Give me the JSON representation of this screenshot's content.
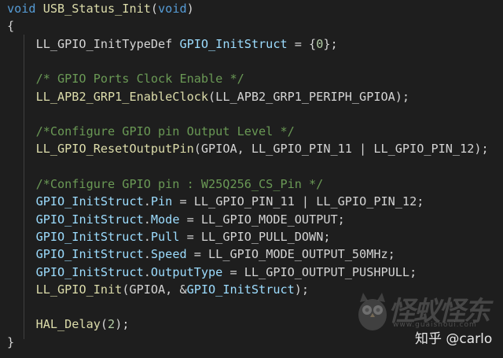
{
  "code_lines": [
    [
      {
        "t": "void ",
        "c": "kw"
      },
      {
        "t": "USB_Status_Init",
        "c": "fn"
      },
      {
        "t": "(",
        "c": "pl"
      },
      {
        "t": "void",
        "c": "kw"
      },
      {
        "t": ")",
        "c": "pl"
      }
    ],
    [
      {
        "t": "{",
        "c": "pl"
      }
    ],
    [
      {
        "t": "    LL_GPIO_InitTypeDef ",
        "c": "pl"
      },
      {
        "t": "GPIO_InitStruct",
        "c": "var"
      },
      {
        "t": " = {",
        "c": "pl"
      },
      {
        "t": "0",
        "c": "num"
      },
      {
        "t": "};",
        "c": "pl"
      }
    ],
    [],
    [
      {
        "t": "    /* GPIO Ports Clock Enable */",
        "c": "cm"
      }
    ],
    [
      {
        "t": "    ",
        "c": "pl"
      },
      {
        "t": "LL_APB2_GRP1_EnableClock",
        "c": "fn"
      },
      {
        "t": "(LL_APB2_GRP1_PERIPH_GPIOA);",
        "c": "pl"
      }
    ],
    [],
    [
      {
        "t": "    /*Configure GPIO pin Output Level */",
        "c": "cm"
      }
    ],
    [
      {
        "t": "    ",
        "c": "pl"
      },
      {
        "t": "LL_GPIO_ResetOutputPin",
        "c": "fn"
      },
      {
        "t": "(GPIOA, LL_GPIO_PIN_11 | LL_GPIO_PIN_12);",
        "c": "pl"
      }
    ],
    [],
    [
      {
        "t": "    /*Configure GPIO pin : W25Q256_CS_Pin */",
        "c": "cm"
      }
    ],
    [
      {
        "t": "    ",
        "c": "pl"
      },
      {
        "t": "GPIO_InitStruct",
        "c": "var"
      },
      {
        "t": ".",
        "c": "pl"
      },
      {
        "t": "Pin",
        "c": "var"
      },
      {
        "t": " = LL_GPIO_PIN_11 | LL_GPIO_PIN_12;",
        "c": "pl"
      }
    ],
    [
      {
        "t": "    ",
        "c": "pl"
      },
      {
        "t": "GPIO_InitStruct",
        "c": "var"
      },
      {
        "t": ".",
        "c": "pl"
      },
      {
        "t": "Mode",
        "c": "var"
      },
      {
        "t": " = LL_GPIO_MODE_OUTPUT;",
        "c": "pl"
      }
    ],
    [
      {
        "t": "    ",
        "c": "pl"
      },
      {
        "t": "GPIO_InitStruct",
        "c": "var"
      },
      {
        "t": ".",
        "c": "pl"
      },
      {
        "t": "Pull",
        "c": "var"
      },
      {
        "t": " = LL_GPIO_PULL_DOWN;",
        "c": "pl"
      }
    ],
    [
      {
        "t": "    ",
        "c": "pl"
      },
      {
        "t": "GPIO_InitStruct",
        "c": "var"
      },
      {
        "t": ".",
        "c": "pl"
      },
      {
        "t": "Speed",
        "c": "var"
      },
      {
        "t": " = LL_GPIO_MODE_OUTPUT_50MHz;",
        "c": "pl"
      }
    ],
    [
      {
        "t": "    ",
        "c": "pl"
      },
      {
        "t": "GPIO_InitStruct",
        "c": "var"
      },
      {
        "t": ".",
        "c": "pl"
      },
      {
        "t": "OutputType",
        "c": "var"
      },
      {
        "t": " = LL_GPIO_OUTPUT_PUSHPULL;",
        "c": "pl"
      }
    ],
    [
      {
        "t": "    ",
        "c": "pl"
      },
      {
        "t": "LL_GPIO_Init",
        "c": "fn"
      },
      {
        "t": "(GPIOA, &",
        "c": "pl"
      },
      {
        "t": "GPIO_InitStruct",
        "c": "var"
      },
      {
        "t": ");",
        "c": "pl"
      }
    ],
    [],
    [
      {
        "t": "    ",
        "c": "pl"
      },
      {
        "t": "HAL_Delay",
        "c": "fn"
      },
      {
        "t": "(",
        "c": "pl"
      },
      {
        "t": "2",
        "c": "num"
      },
      {
        "t": ");",
        "c": "pl"
      }
    ],
    [
      {
        "t": "}",
        "c": "pl"
      }
    ]
  ],
  "watermark": {
    "logo_text": "怪蚁怪东",
    "url": "www.guaishoui.com"
  },
  "credit": "知乎 @carlo",
  "colors": {
    "background": "#1e1e1e",
    "keyword": "#569cd6",
    "function": "#dcdcaa",
    "variable": "#9cdcfe",
    "number": "#b5cea8",
    "comment": "#6a9955",
    "text": "#d4d4d4"
  },
  "icons": [
    "owl-mascot-icon"
  ]
}
